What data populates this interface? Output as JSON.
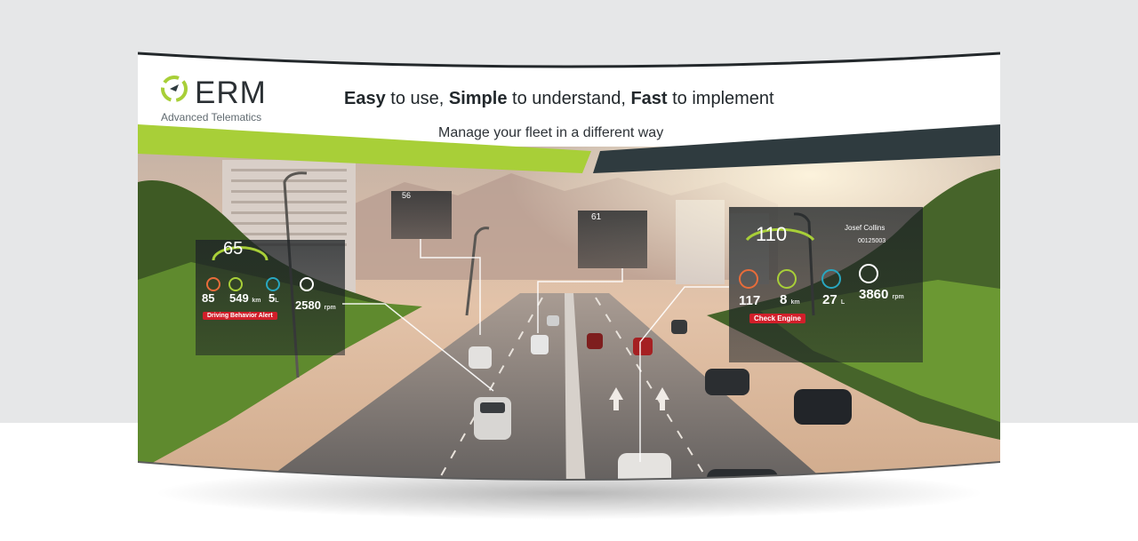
{
  "brand": {
    "name": "ERM",
    "tagline": "Advanced Telematics"
  },
  "headline": {
    "part1": "Easy",
    "part2": " to use, ",
    "part3": "Simple",
    "part4": " to understand, ",
    "part5": "Fast",
    "part6": " to implement"
  },
  "subheadline": "Manage your fleet in a different way",
  "colors": {
    "green": "#a8cf38",
    "dark": "#2f3b3f",
    "alert": "#d21f2a"
  },
  "hud_left": {
    "speed": "65",
    "temp": "85",
    "distance": "549",
    "distance_unit": "km",
    "fuel": "5",
    "fuel_unit": "L",
    "rpm": "2580",
    "rpm_unit": "rpm",
    "alert": "Driving Behavior Alert"
  },
  "hud_right": {
    "speed": "110",
    "driver": "Josef Collins",
    "id": "00125003",
    "temp": "117",
    "distance": "8",
    "distance_unit": "km",
    "fuel": "27",
    "fuel_unit": "L",
    "rpm": "3860",
    "rpm_unit": "rpm",
    "alert": "Check Engine"
  },
  "hud_top_left": {
    "speed": "56"
  },
  "hud_top_mid": {
    "speed": "61"
  }
}
